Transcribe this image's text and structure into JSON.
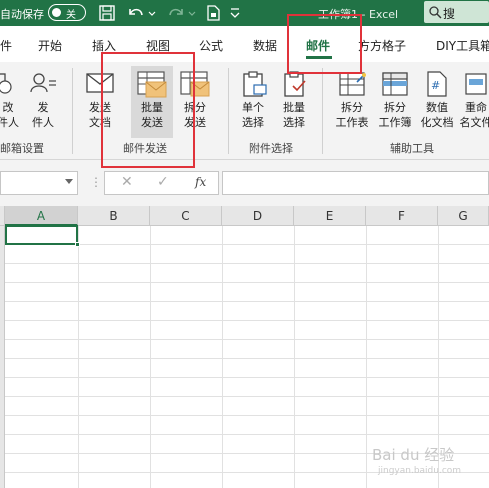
{
  "titlebar": {
    "autosave_label": "自动保存",
    "autosave_state": "关",
    "doc_title": "工作簿1 - Excel",
    "search_label": "搜"
  },
  "tabs": [
    "件",
    "开始",
    "插入",
    "视图",
    "公式",
    "数据",
    "邮件",
    "方方格子",
    "DIY工具箱"
  ],
  "active_tab": "邮件",
  "ribbon": {
    "group_mailbox": {
      "label": "邮箱设置",
      "btn1": "改收件人",
      "btn1_l1": "改",
      "btn1_l2": "件人",
      "btn2_l1": "发",
      "btn2_l2": "件人"
    },
    "group_mail": {
      "label": "邮件发送",
      "send_doc_l1": "发送",
      "send_doc_l2": "文档",
      "batch_l1": "批量",
      "batch_l2": "发送",
      "split_l1": "拆分",
      "split_l2": "发送"
    },
    "group_attach": {
      "label": "附件选择",
      "single_l1": "单个",
      "single_l2": "选择",
      "batch_l1": "批量",
      "batch_l2": "选择"
    },
    "group_tools": {
      "label": "辅助工具",
      "split_table_l1": "拆分",
      "split_table_l2": "工作表",
      "split_book_l1": "拆分",
      "split_book_l2": "工作簿",
      "numdoc_l1": "数值",
      "numdoc_l2": "化文档",
      "rename_l1": "重命",
      "rename_l2": "名文件"
    }
  },
  "formula_bar": {
    "cancel": "✕",
    "enter": "✓",
    "fx": "fx",
    "dots": "⋮"
  },
  "grid": {
    "columns": [
      "A",
      "B",
      "C",
      "D",
      "E",
      "F",
      "G"
    ]
  },
  "watermark": {
    "brand": "Bai du 经验",
    "sub": "jingyan.baidu.com"
  },
  "colors": {
    "accent": "#217346",
    "highlight": "#e0323a"
  }
}
